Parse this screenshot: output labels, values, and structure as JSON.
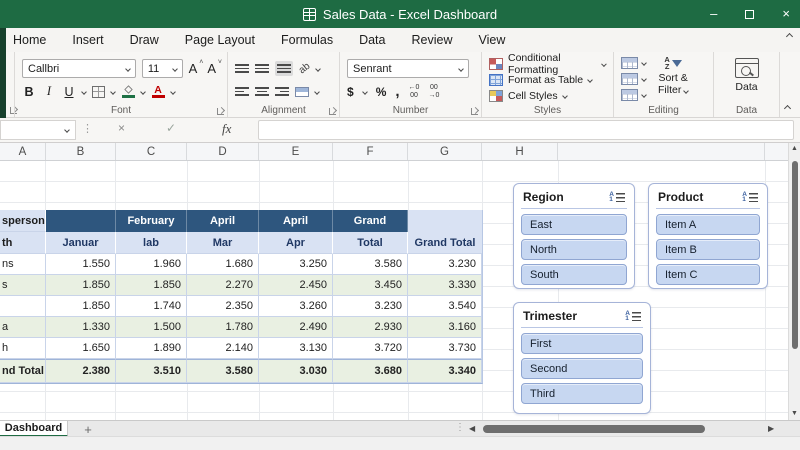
{
  "window": {
    "title": "Sales Data - Excel Dashboard"
  },
  "icons": {
    "minimize": "–",
    "close": "×",
    "check": "✓",
    "cancel": "×",
    "fx": "fx",
    "dots": "⋮",
    "scroll_left": "◀",
    "scroll_right": "▶",
    "scroll_up": "▲",
    "scroll_down": "▼",
    "add_sheet": "+",
    "orientation": "ab",
    "sort_a": "A",
    "sort_z": "Z",
    "slicer_a": "A",
    "slicer_1": "1",
    "grow_font": "A",
    "shrink_font": "A"
  },
  "menu": {
    "tabs": [
      "Home",
      "Insert",
      "Draw",
      "Page Layout",
      "Formulas",
      "Data",
      "Review",
      "View"
    ]
  },
  "ribbon": {
    "font_group": {
      "label": "Font",
      "font_name": "Callbri",
      "font_size": "11",
      "bold": "B",
      "italic": "I",
      "underline": "U"
    },
    "alignment_group": {
      "label": "Alignment"
    },
    "number_group": {
      "label": "Number",
      "format": "Senrant",
      "currency": "$",
      "percent": "%",
      "comma": ",",
      "inc_decimal": "←0\n00",
      "dec_decimal": "00\n→0"
    },
    "styles_group": {
      "label": "Styles",
      "items": [
        "Conditional Formatting",
        "Format as Table",
        "Cell Styles"
      ]
    },
    "editing_group": {
      "label": "Editing",
      "sort_line1": "Sort &",
      "sort_line2": "Filter"
    },
    "data_group": {
      "label": "Data",
      "button": "Data"
    }
  },
  "grid": {
    "columns": [
      "A",
      "B",
      "C",
      "D",
      "E",
      "F",
      "G",
      "H"
    ]
  },
  "pivot": {
    "row_header_title": "sperson",
    "row_header_sub": "th",
    "col_groups": [
      "",
      "February",
      "April",
      "April",
      "Grand"
    ],
    "col_headers": [
      "Januar",
      "lab",
      "Mar",
      "Apr",
      "Total"
    ],
    "grand_total_col": "Grand Total",
    "rows": [
      {
        "label": "ns",
        "values": [
          "1.550",
          "1.960",
          "1.680",
          "3.250",
          "3.580",
          "3.230"
        ]
      },
      {
        "label": "s",
        "values": [
          "1.850",
          "1.850",
          "2.270",
          "2.450",
          "3.450",
          "3.330"
        ]
      },
      {
        "label": "",
        "values": [
          "1.850",
          "1.740",
          "2.350",
          "3.260",
          "3.230",
          "3.540"
        ]
      },
      {
        "label": "a",
        "values": [
          "1.330",
          "1.500",
          "1.780",
          "2.490",
          "2.930",
          "3.160"
        ]
      },
      {
        "label": "h",
        "values": [
          "1.650",
          "1.890",
          "2.140",
          "3.130",
          "3.720",
          "3.730"
        ]
      }
    ],
    "total_row": {
      "label": "nd Total",
      "values": [
        "2.380",
        "3.510",
        "3.580",
        "3.030",
        "3.680",
        "3.340"
      ]
    }
  },
  "slicers": [
    {
      "title": "Region",
      "items": [
        "East",
        "North",
        "South"
      ]
    },
    {
      "title": "Product",
      "items": [
        "Item A",
        "Item B",
        "Item C"
      ]
    },
    {
      "title": "Trimester",
      "items": [
        "First",
        "Second",
        "Third"
      ]
    }
  ],
  "sheet_bar": {
    "active_tab": "Dashboard"
  },
  "colors": {
    "title_bar_green": "#1E6B43",
    "header_dark_blue": "#2E567E",
    "header_light_blue": "#D9E2F3",
    "row_alt_green": "#E9F0E2",
    "slicer_item_fill": "#C7D7F1",
    "slicer_border": "#A6B4D8",
    "fill_color_swatch": "#1E7145",
    "font_color_swatch": "#C00000"
  }
}
